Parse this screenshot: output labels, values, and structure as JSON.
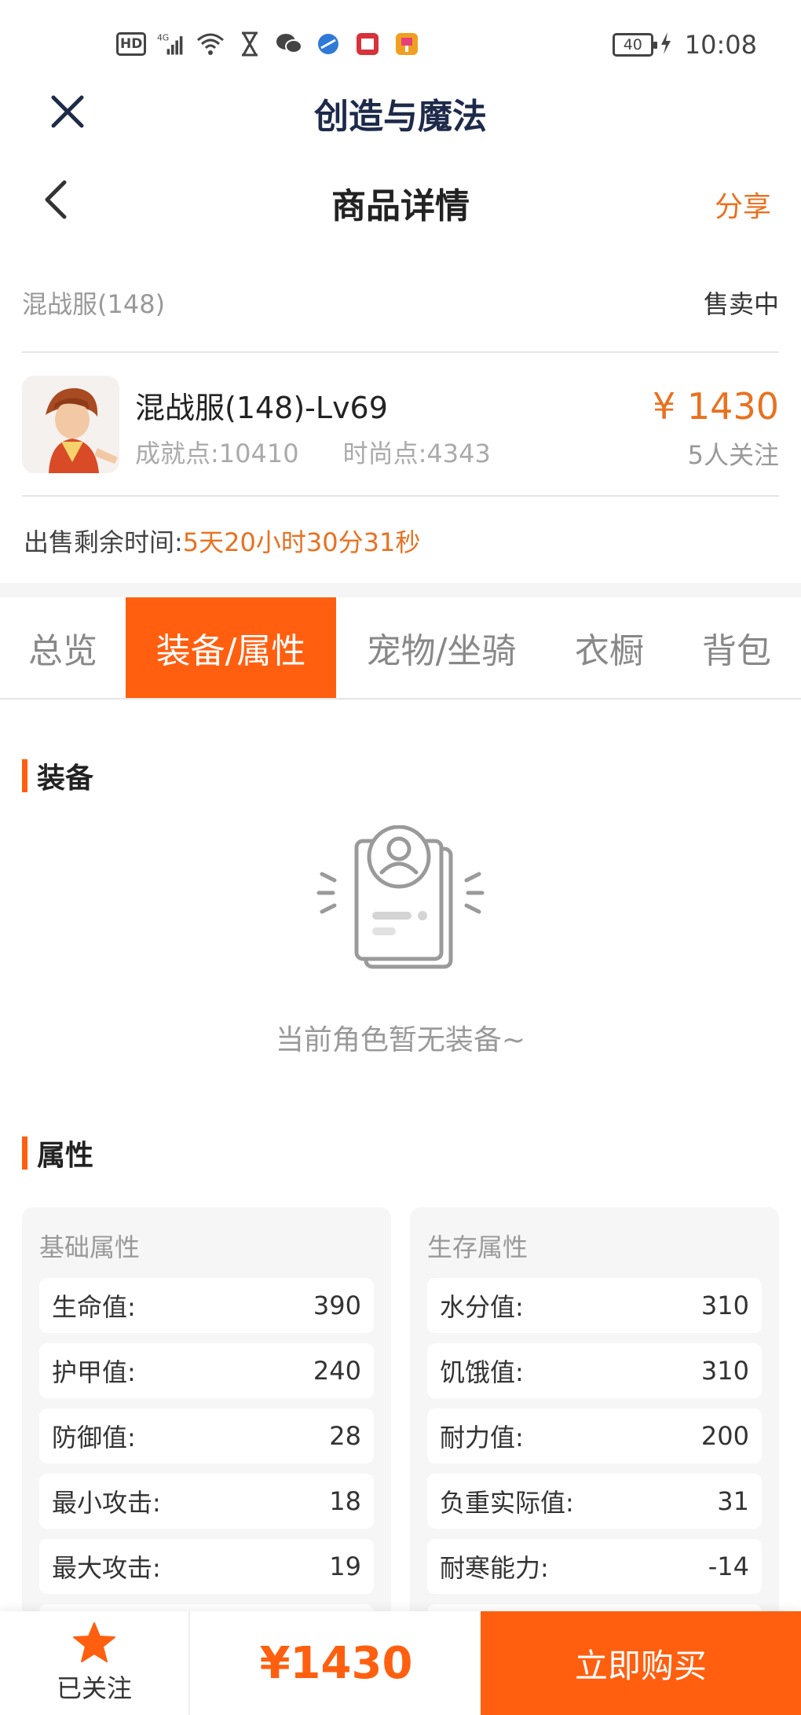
{
  "status_bar": {
    "hd": "HD",
    "network": "4G",
    "battery": "40",
    "time": "10:08"
  },
  "app": {
    "title": "创造与魔法"
  },
  "page": {
    "title": "商品详情",
    "share": "分享"
  },
  "item": {
    "server": "混战服(148)",
    "status": "售卖中",
    "name": "混战服(148)-Lv69",
    "achievement": "成就点:10410",
    "fashion": "时尚点:4343",
    "price": "¥ 1430",
    "followers": "5人关注",
    "remain_label": "出售剩余时间:",
    "remain_value": "5天20小时30分31秒"
  },
  "tabs": [
    {
      "label": "总览",
      "active": false
    },
    {
      "label": "装备/属性",
      "active": true
    },
    {
      "label": "宠物/坐骑",
      "active": false
    },
    {
      "label": "衣橱",
      "active": false
    },
    {
      "label": "背包",
      "active": false
    }
  ],
  "equipment": {
    "title": "装备",
    "empty_text": "当前角色暂无装备~"
  },
  "attributes": {
    "title": "属性",
    "basic": {
      "title": "基础属性",
      "rows": [
        {
          "label": "生命值:",
          "value": "390"
        },
        {
          "label": "护甲值:",
          "value": "240"
        },
        {
          "label": "防御值:",
          "value": "28"
        },
        {
          "label": "最小攻击:",
          "value": "18"
        },
        {
          "label": "最大攻击:",
          "value": "19"
        }
      ]
    },
    "survival": {
      "title": "生存属性",
      "rows": [
        {
          "label": "水分值:",
          "value": "310"
        },
        {
          "label": "饥饿值:",
          "value": "310"
        },
        {
          "label": "耐力值:",
          "value": "200"
        },
        {
          "label": "负重实际值:",
          "value": "31"
        },
        {
          "label": "耐寒能力:",
          "value": "-14"
        }
      ]
    }
  },
  "bottom_bar": {
    "follow_label": "已关注",
    "price": "¥1430",
    "buy_label": "立即购买"
  },
  "colors": {
    "accent": "#ff5f0f",
    "price": "#e9711f",
    "title": "#1e2a4a"
  }
}
